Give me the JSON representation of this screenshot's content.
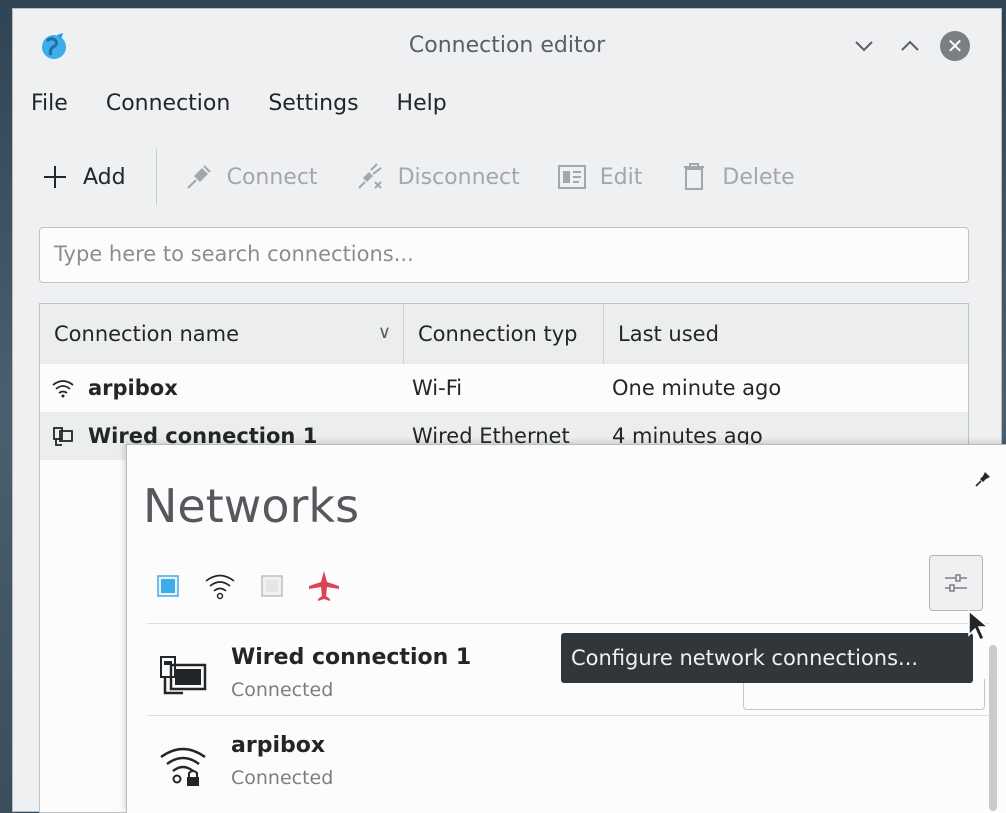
{
  "window": {
    "title": "Connection editor",
    "icons": {
      "app": "globe-app-icon",
      "minimize": "chevron-down-icon",
      "maximize": "chevron-up-icon",
      "close": "close-icon"
    }
  },
  "menu": [
    "File",
    "Connection",
    "Settings",
    "Help"
  ],
  "toolbar": {
    "add": "Add",
    "connect": "Connect",
    "disconnect": "Disconnect",
    "edit": "Edit",
    "delete": "Delete"
  },
  "search": {
    "placeholder": "Type here to search connections..."
  },
  "table": {
    "columns": [
      "Connection name",
      "Connection typ",
      "Last used"
    ],
    "rows": [
      {
        "icon": "wifi-icon",
        "name": "arpibox",
        "type": "Wi-Fi",
        "last_used": "One minute ago"
      },
      {
        "icon": "ethernet-icon",
        "name": "Wired connection 1",
        "type": "Wired Ethernet",
        "last_used": "4 minutes ago"
      }
    ]
  },
  "networks_popup": {
    "title": "Networks",
    "quick_toggles": [
      "ethernet-toggle-icon",
      "wifi-toggle-icon",
      "mobile-toggle-icon",
      "airplane-mode-icon"
    ],
    "tooltip": "Configure network connections...",
    "items": [
      {
        "name": "Wired connection 1",
        "status": "Connected",
        "icon": "wired-computer-icon"
      },
      {
        "name": "arpibox",
        "status": "Connected",
        "icon": "wifi-lock-icon"
      }
    ]
  },
  "colors": {
    "accent": "#3daee9",
    "airplane": "#da4453",
    "tooltip_bg": "#31363b"
  }
}
